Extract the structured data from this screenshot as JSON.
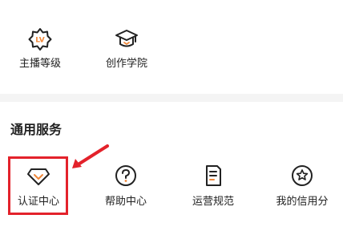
{
  "top_row": [
    {
      "label": "主播等级",
      "icon": "lv-badge-icon"
    },
    {
      "label": "创作学院",
      "icon": "graduation-cap-icon"
    }
  ],
  "services": {
    "title": "通用服务",
    "items": [
      {
        "label": "认证中心",
        "icon": "diamond-icon"
      },
      {
        "label": "帮助中心",
        "icon": "question-circle-icon"
      },
      {
        "label": "运营规范",
        "icon": "document-icon"
      },
      {
        "label": "我的信用分",
        "icon": "star-circle-icon"
      }
    ]
  },
  "icon_texts": {
    "lv": "LV"
  },
  "colors": {
    "accent_orange": "#f0883a",
    "highlight_red": "#e3222b",
    "text": "#222222"
  }
}
